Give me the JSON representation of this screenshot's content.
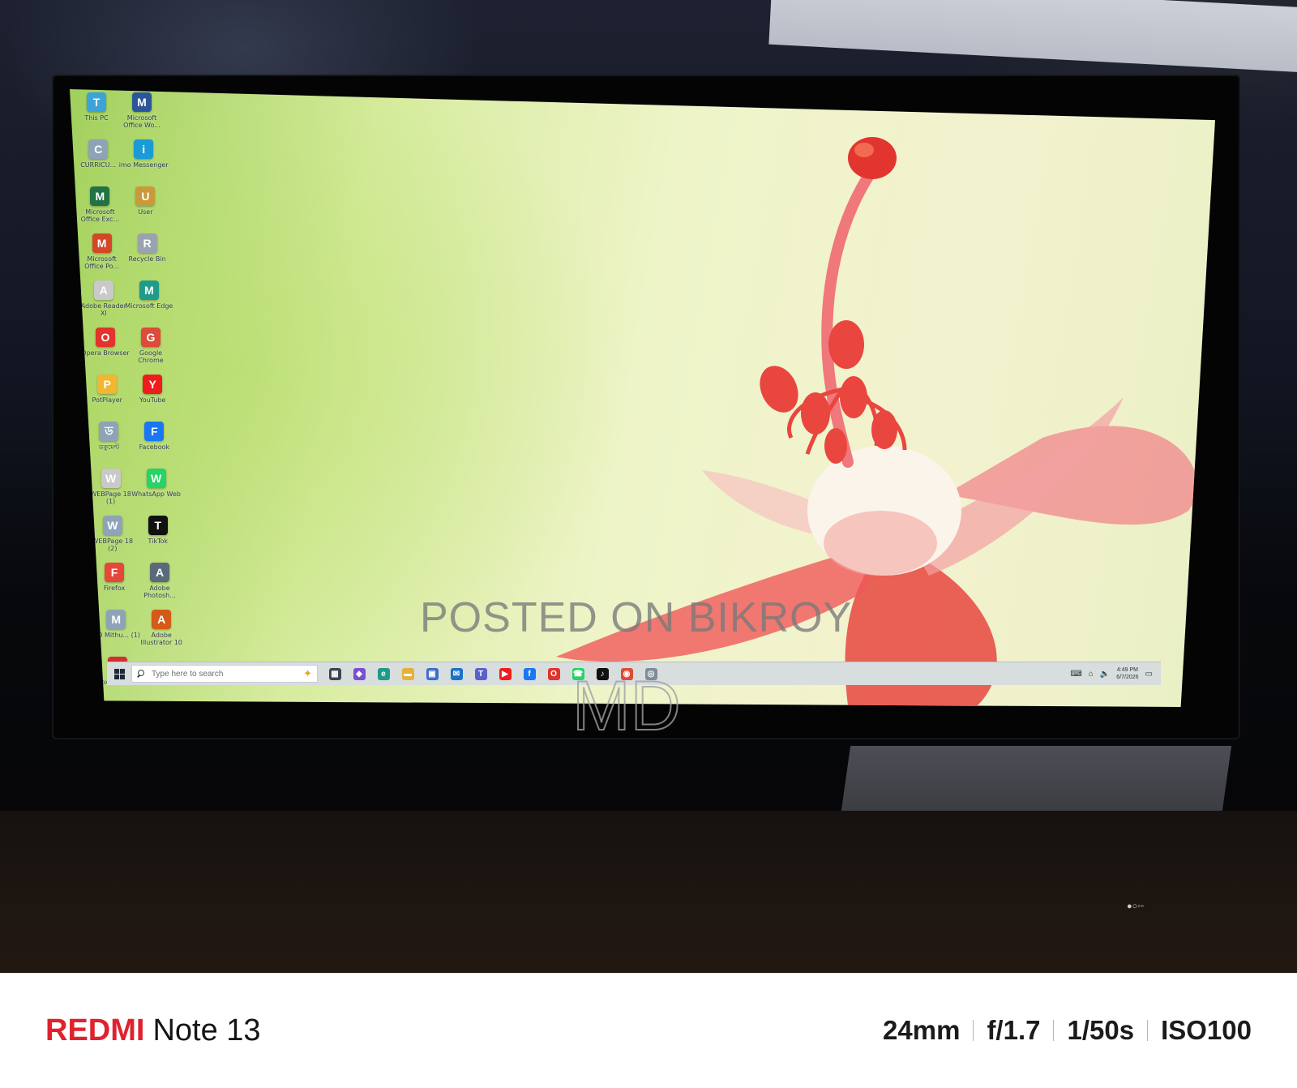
{
  "desktop_icons": [
    {
      "label": "This PC",
      "icon": "this-pc-icon",
      "color": "#3ba3d8"
    },
    {
      "label": "Microsoft Office Wo...",
      "icon": "word-icon",
      "color": "#2b579a"
    },
    {
      "label": "CURRICU...",
      "icon": "document-icon",
      "color": "#8fa3b8"
    },
    {
      "label": "imo Messenger",
      "icon": "imo-icon",
      "color": "#1b9ad6"
    },
    {
      "label": "Microsoft Office Exc...",
      "icon": "excel-icon",
      "color": "#217346"
    },
    {
      "label": "User",
      "icon": "user-folder-icon",
      "color": "#c99a3a"
    },
    {
      "label": "Microsoft Office Po...",
      "icon": "powerpoint-icon",
      "color": "#d24726"
    },
    {
      "label": "Recycle Bin",
      "icon": "recycle-bin-icon",
      "color": "#9aa3ad"
    },
    {
      "label": "Adobe Reader XI",
      "icon": "pdf-file-icon",
      "color": "#c9c9c9"
    },
    {
      "label": "Microsoft Edge",
      "icon": "edge-icon",
      "color": "#1f9b8a"
    },
    {
      "label": "Opera Browser",
      "icon": "opera-icon",
      "color": "#e0342c"
    },
    {
      "label": "Google Chrome",
      "icon": "chrome-icon",
      "color": "#dd4b39"
    },
    {
      "label": "PotPlayer",
      "icon": "potplayer-icon",
      "color": "#f2b632"
    },
    {
      "label": "YouTube",
      "icon": "youtube-icon",
      "color": "#ee1c1c"
    },
    {
      "label": "ডকুমেন্ট",
      "icon": "document-icon",
      "color": "#8fa3b8"
    },
    {
      "label": "Facebook",
      "icon": "facebook-icon",
      "color": "#1877f2"
    },
    {
      "label": "WEBPage 18 (1)",
      "icon": "pdf-file-icon",
      "color": "#c9c9c9"
    },
    {
      "label": "WhatsApp Web",
      "icon": "whatsapp-icon",
      "color": "#25d366"
    },
    {
      "label": "WEBPage 18 (2)",
      "icon": "document-icon",
      "color": "#8fa3b8"
    },
    {
      "label": "TikTok",
      "icon": "tiktok-icon",
      "color": "#111111"
    },
    {
      "label": "Firefox",
      "icon": "firefox-icon",
      "color": "#e5483b"
    },
    {
      "label": "Adobe Photosh...",
      "icon": "photoshop-icon",
      "color": "#5a6a78"
    },
    {
      "label": "MD Mithu... (1)",
      "icon": "document-icon",
      "color": "#8fa3b8"
    },
    {
      "label": "Adobe Illustrator 10",
      "icon": "illustrator-icon",
      "color": "#d45a17"
    },
    {
      "label": "Foxit Reader",
      "icon": "foxit-icon",
      "color": "#d32f2f"
    }
  ],
  "taskbar": {
    "search_placeholder": "Type here to search",
    "apps": [
      {
        "name": "task-view",
        "icon": "task-view-icon",
        "color": "#3d4650",
        "glyph": "▦"
      },
      {
        "name": "copilot",
        "icon": "copilot-icon",
        "color": "#7a4fd1",
        "glyph": "◆"
      },
      {
        "name": "edge",
        "icon": "edge-icon",
        "color": "#1f9b8a",
        "glyph": "e"
      },
      {
        "name": "file-explorer",
        "icon": "folder-icon",
        "color": "#e3b13c",
        "glyph": "▬"
      },
      {
        "name": "store",
        "icon": "store-icon",
        "color": "#3b6fc5",
        "glyph": "▣"
      },
      {
        "name": "outlook",
        "icon": "outlook-icon",
        "color": "#1a73c8",
        "glyph": "✉"
      },
      {
        "name": "teams",
        "icon": "teams-icon",
        "color": "#5b62c7",
        "glyph": "T"
      },
      {
        "name": "youtube",
        "icon": "youtube-icon",
        "color": "#ee1c1c",
        "glyph": "▶"
      },
      {
        "name": "facebook",
        "icon": "facebook-icon",
        "color": "#1877f2",
        "glyph": "f"
      },
      {
        "name": "opera",
        "icon": "opera-icon",
        "color": "#e0342c",
        "glyph": "O"
      },
      {
        "name": "whatsapp",
        "icon": "whatsapp-icon",
        "color": "#25d366",
        "glyph": "☎"
      },
      {
        "name": "tiktok",
        "icon": "tiktok-icon",
        "color": "#111111",
        "glyph": "♪"
      },
      {
        "name": "chrome",
        "icon": "chrome-icon",
        "color": "#dd4b39",
        "glyph": "◉"
      },
      {
        "name": "messenger",
        "icon": "messenger-icon",
        "color": "#7f8c99",
        "glyph": "◎"
      }
    ],
    "tray": {
      "keyboard": "⌨",
      "network": "⌂",
      "volume": "🔈",
      "time": "4:49 PM",
      "date": "6/7/2026",
      "notification": "▭"
    }
  },
  "watermark": {
    "line1": "POSTED ON BIKROY",
    "line2": "MD"
  },
  "photo_footer": {
    "brand": "REDMI",
    "model": "Note 13",
    "focal_length": "24mm",
    "aperture": "f/1.7",
    "shutter": "1/50s",
    "iso": "ISO100"
  },
  "colors": {
    "wallpaper_green": "#9fcf5c",
    "wallpaper_cream": "#f3f2cf",
    "flower_red": "#e8463e",
    "brand_red": "#e0222e"
  }
}
